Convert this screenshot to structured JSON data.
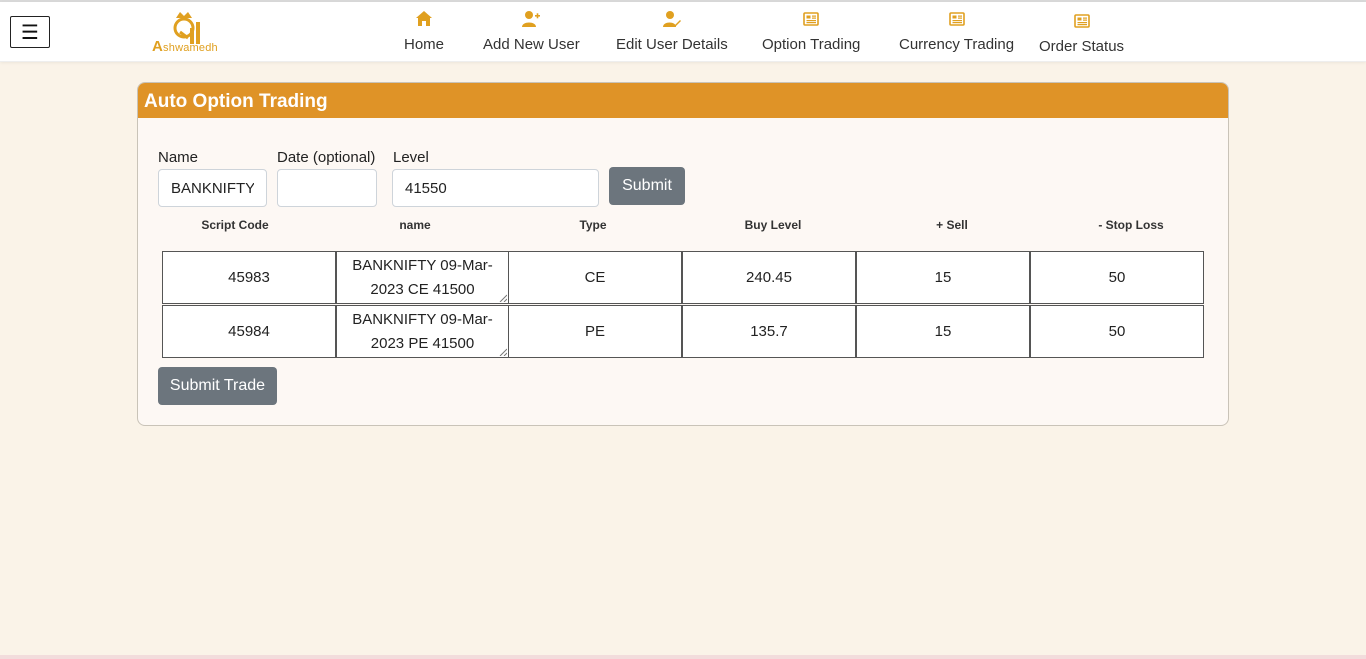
{
  "nav": {
    "logo_text_a": "A",
    "logo_text_rest": "shwamedh",
    "items": [
      {
        "label": "Home",
        "icon": "home-icon"
      },
      {
        "label": "Add New User",
        "icon": "user-plus-icon"
      },
      {
        "label": "Edit User Details",
        "icon": "user-edit-icon"
      },
      {
        "label": "Option Trading",
        "icon": "newspaper-icon"
      },
      {
        "label": "Currency Trading",
        "icon": "newspaper-icon"
      },
      {
        "label": "Order Status",
        "icon": "newspaper-icon"
      }
    ],
    "accent": "#e0a020"
  },
  "card": {
    "title": "Auto Option Trading",
    "header_color": "#df9327"
  },
  "form": {
    "name_label": "Name",
    "name_value": "BANKNIFTY",
    "date_label": "Date (optional)",
    "date_value": "",
    "level_label": "Level",
    "level_value": "41550",
    "submit_label": "Submit"
  },
  "table": {
    "columns": [
      "Script Code",
      "name",
      "Type",
      "Buy Level",
      "+ Sell",
      "- Stop Loss"
    ],
    "rows": [
      {
        "code": "45983",
        "name": "BANKNIFTY 09-Mar-2023 CE 41500",
        "type": "CE",
        "buy": "240.45",
        "sell": "15",
        "stop": "50"
      },
      {
        "code": "45984",
        "name": "BANKNIFTY 09-Mar-2023 PE 41500",
        "type": "PE",
        "buy": "135.7",
        "sell": "15",
        "stop": "50"
      }
    ]
  },
  "submit_trade_label": "Submit Trade"
}
